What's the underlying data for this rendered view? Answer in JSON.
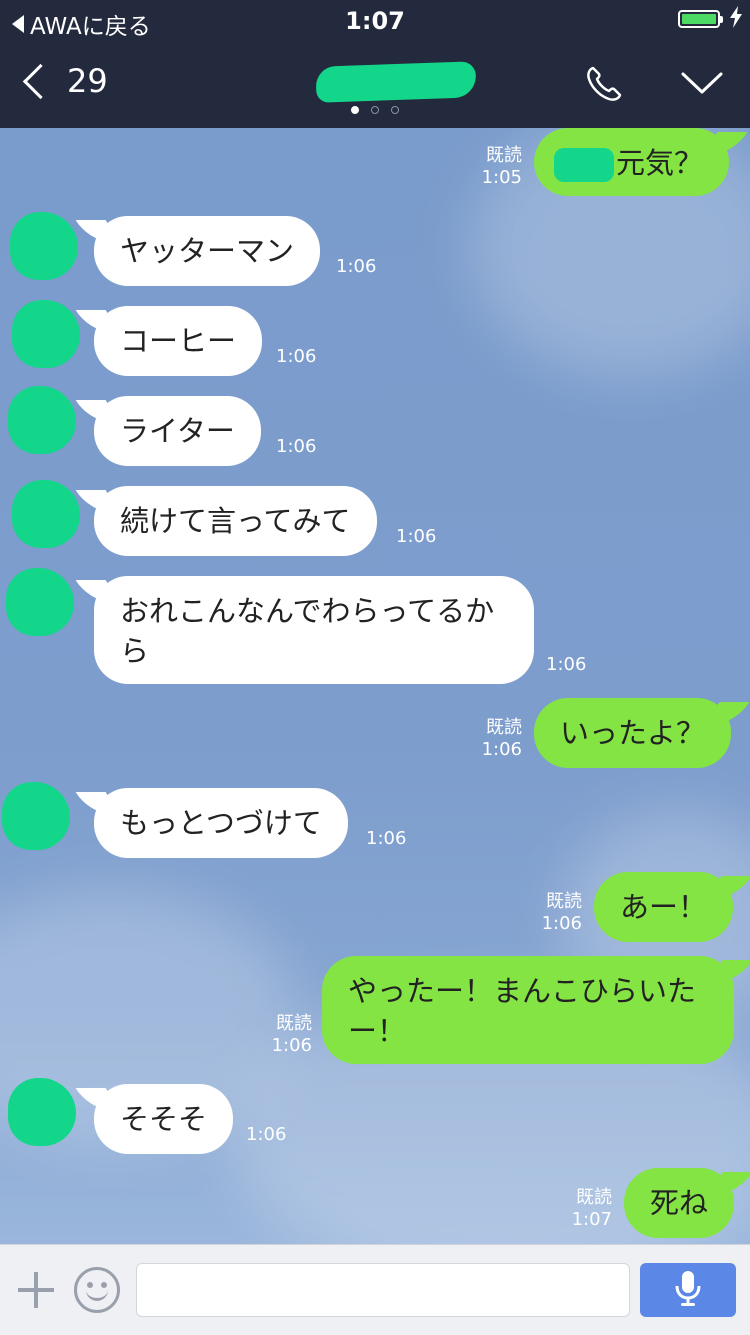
{
  "status_bar": {
    "back_app": "AWAに戻る",
    "time": "1:07",
    "battery": "charging"
  },
  "nav": {
    "back_count": "29",
    "contact_name": "",
    "page_dots": [
      true,
      false,
      false
    ],
    "call_icon": "phone-icon",
    "menu_icon": "chevron-down-icon"
  },
  "messages": [
    {
      "side": "out",
      "text": "元気？",
      "read": "既読",
      "time": "1:05"
    },
    {
      "side": "in",
      "text": "ヤッターマン",
      "time": "1:06"
    },
    {
      "side": "in",
      "text": "コーヒー",
      "time": "1:06"
    },
    {
      "side": "in",
      "text": "ライター",
      "time": "1:06"
    },
    {
      "side": "in",
      "text": "続けて言ってみて",
      "time": "1:06"
    },
    {
      "side": "in",
      "text": "おれこんなんでわらってるか",
      "text2": "ら",
      "time": "1:06"
    },
    {
      "side": "out",
      "text": "いったよ？",
      "read": "既読",
      "time": "1:06"
    },
    {
      "side": "in",
      "text": "もっとつづけて",
      "time": "1:06"
    },
    {
      "side": "out",
      "text": "あー！",
      "read": "既読",
      "time": "1:06"
    },
    {
      "side": "out",
      "text": "やったー！まんこひらいた",
      "text2": "ー！",
      "read": "既読",
      "time": "1:06"
    },
    {
      "side": "in",
      "text": "そそそ",
      "time": "1:06"
    },
    {
      "side": "out",
      "text": "死ね",
      "read": "既読",
      "time": "1:07"
    }
  ],
  "input_bar": {
    "placeholder": "",
    "plus_icon": "plus-icon",
    "emoji_icon": "smiley-icon",
    "mic_icon": "microphone-icon"
  },
  "colors": {
    "header": "#232a3d",
    "outgoing": "#84e444",
    "incoming": "#ffffff",
    "mic_button": "#5b87e6"
  }
}
